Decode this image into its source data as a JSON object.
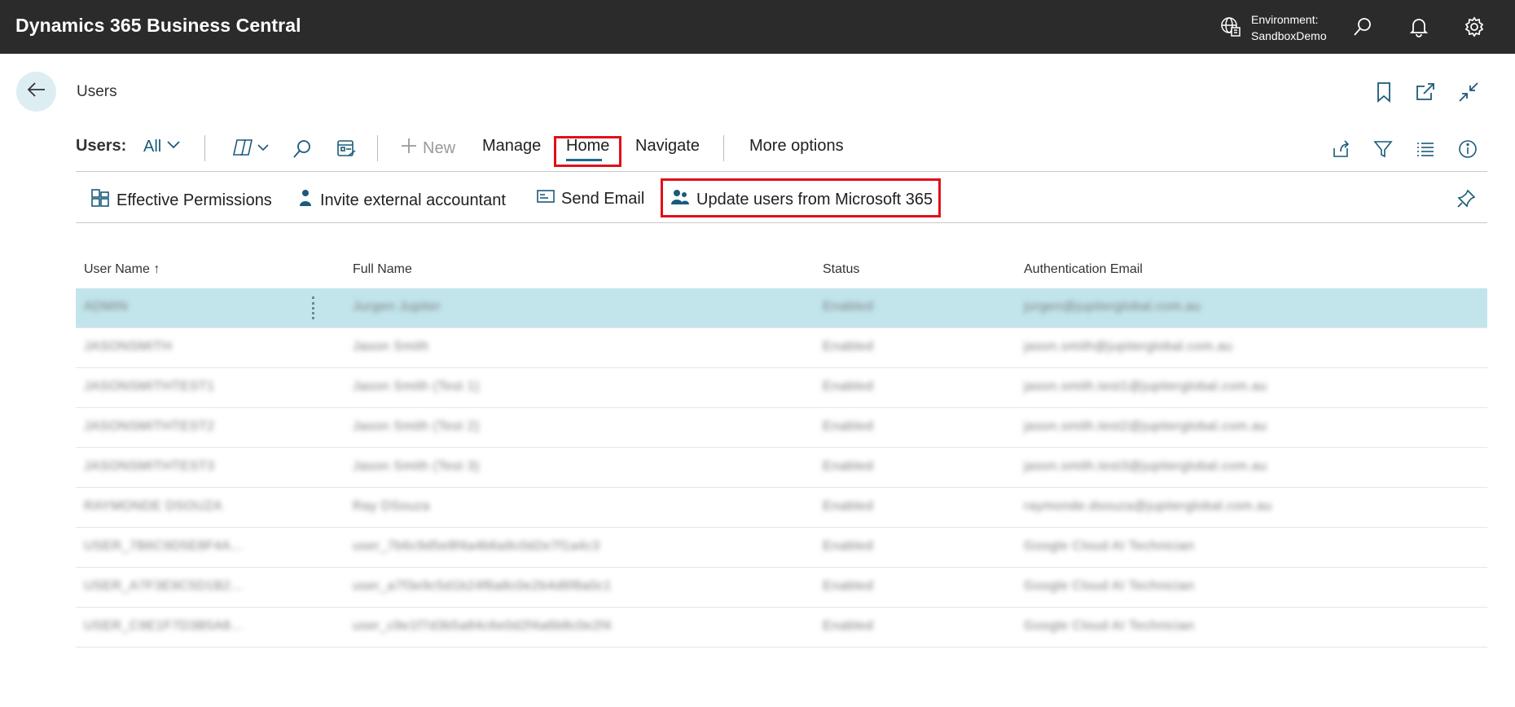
{
  "app": {
    "title": "Dynamics 365 Business Central",
    "environment_label": "Environment:",
    "environment_value": "SandboxDemo"
  },
  "icons": {
    "environment": "globe-building-icon",
    "search": "search-icon",
    "notifications": "bell-icon",
    "settings": "gear-icon",
    "back": "arrow-left-icon",
    "bookmark": "bookmark-icon",
    "open_new": "open-in-new-window-icon",
    "collapse": "collapse-icon"
  },
  "page": {
    "title": "Users"
  },
  "actionbar": {
    "users_label": "Users:",
    "filter_view": "All",
    "new_label": "New",
    "manage_label": "Manage",
    "home_label": "Home",
    "navigate_label": "Navigate",
    "more_options_label": "More options"
  },
  "subbar": {
    "effective_permissions": "Effective Permissions",
    "invite_external_accountant": "Invite external accountant",
    "send_email": "Send Email",
    "update_users": "Update users from Microsoft 365"
  },
  "table": {
    "columns": [
      "User Name",
      "Full Name",
      "Status",
      "Authentication Email"
    ],
    "sort_indicator": "↑",
    "rows": [
      {
        "user_name": "ADMIN",
        "full_name": "Jurgen Jupiter",
        "status": "Enabled",
        "email": "jurgen@jupiterglobal.com.au"
      },
      {
        "user_name": "JASONSMITH",
        "full_name": "Jason Smith",
        "status": "Enabled",
        "email": "jason.smith@jupiterglobal.com.au"
      },
      {
        "user_name": "JASONSMITHTEST1",
        "full_name": "Jason Smith (Test 1)",
        "status": "Enabled",
        "email": "jason.smith.test1@jupiterglobal.com.au"
      },
      {
        "user_name": "JASONSMITHTEST2",
        "full_name": "Jason Smith (Test 2)",
        "status": "Enabled",
        "email": "jason.smith.test2@jupiterglobal.com.au"
      },
      {
        "user_name": "JASONSMITHTEST3",
        "full_name": "Jason Smith (Test 3)",
        "status": "Enabled",
        "email": "jason.smith.test3@jupiterglobal.com.au"
      },
      {
        "user_name": "RAYMONDE DSOUZA",
        "full_name": "Ray DSouza",
        "status": "Enabled",
        "email": "raymonde.dsouza@jupiterglobal.com.au"
      },
      {
        "user_name": "USER_7B6C9D5E8F4A...",
        "full_name": "user_7b6c9d5e8f4a4b6a9c0d2e7f1a4c3",
        "status": "Enabled",
        "email": "Google Cloud AI Technician"
      },
      {
        "user_name": "USER_A7F3E9C5D1B2...",
        "full_name": "user_a7f3e9c5d1b24f6a8c0e2b4d6f8a0c1",
        "status": "Enabled",
        "email": "Google Cloud AI Technician"
      },
      {
        "user_name": "USER_C9E1F7D3B5A8...",
        "full_name": "user_c9e1f7d3b5a84c6e0d2f4a6b8c0e2f4",
        "status": "Enabled",
        "email": "Google Cloud AI Technician"
      }
    ]
  },
  "colors": {
    "topbar": "#2b2b2b",
    "accent": "#1a6b8a",
    "selected_row": "#c2e5ec",
    "highlight": "#e0101a"
  }
}
